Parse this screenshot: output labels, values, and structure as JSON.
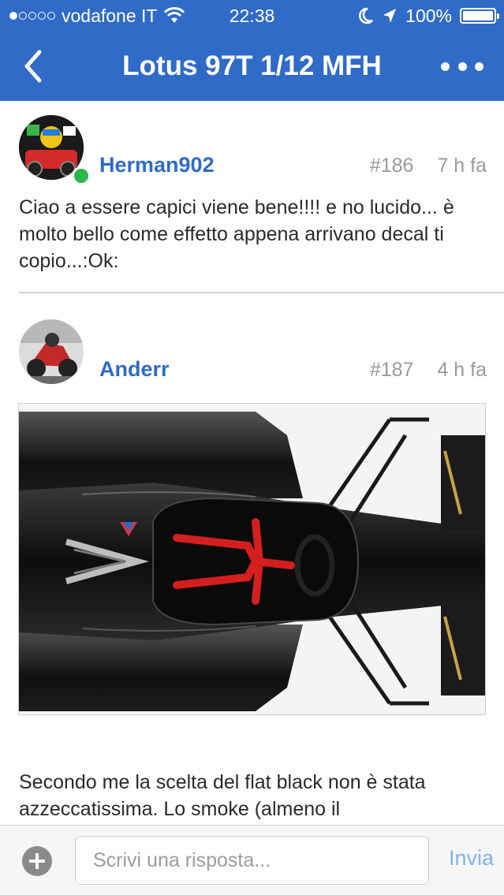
{
  "status_bar": {
    "carrier": "vodafone IT",
    "time": "22:38",
    "battery": "100%"
  },
  "nav": {
    "title": "Lotus 97T 1/12 MFH"
  },
  "posts": [
    {
      "username": "Herman902",
      "number": "#186",
      "time": "7 h fa",
      "online": true,
      "text": "Ciao a essere capici viene bene!!!! e no lucido... è molto bello come effetto appena arrivano decal ti copio...:Ok:"
    },
    {
      "username": "Anderr",
      "number": "#187",
      "time": "4 h fa",
      "text": "Secondo me la scelta del flat black non è stata azzeccatissima. Lo smoke (almeno il"
    }
  ],
  "reply_bar": {
    "placeholder": "Scrivi una risposta...",
    "send_label": "Invia"
  },
  "colors": {
    "header": "#2f6bc7",
    "username": "#2f6bc7",
    "send": "#7fb2ee",
    "online": "#2db84a"
  }
}
